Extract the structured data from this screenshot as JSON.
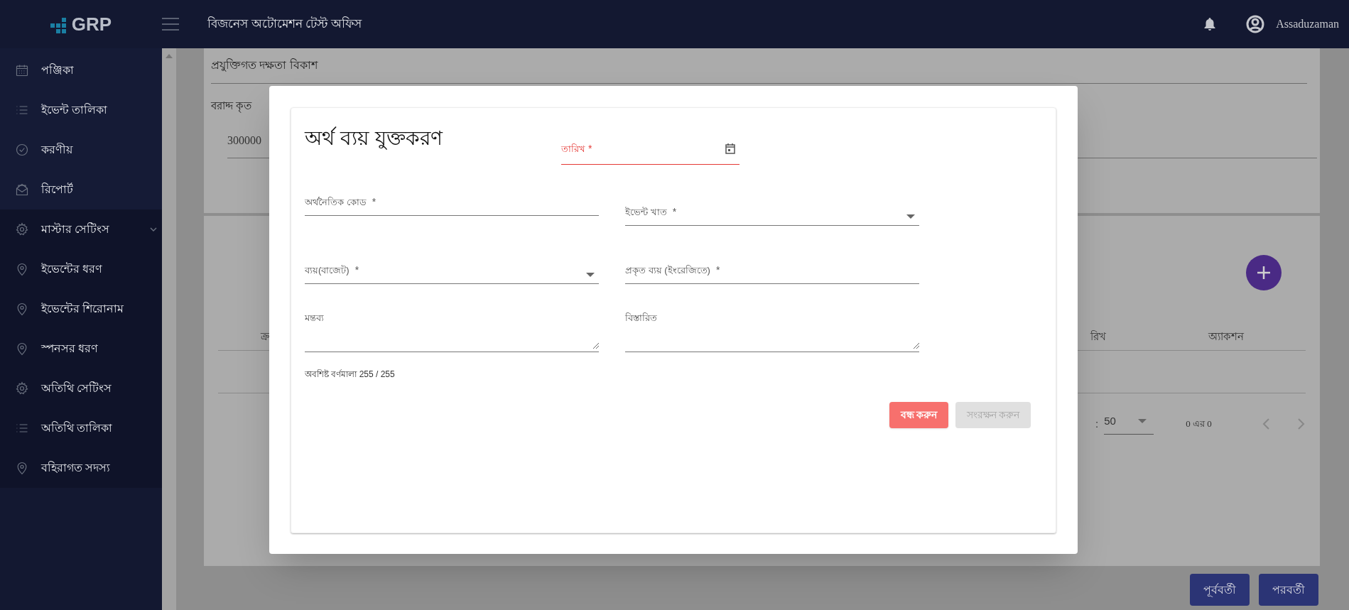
{
  "header": {
    "logo": "GRP",
    "title": "বিজনেস অটোমেশন টেস্ট অফিস",
    "user": "Assaduzaman"
  },
  "sidebar": {
    "items": [
      {
        "label": "পঞ্জিকা",
        "kind": "calendar"
      },
      {
        "label": "ইভেন্ট তালিকা",
        "kind": "list"
      },
      {
        "label": "করণীয়",
        "kind": "check"
      },
      {
        "label": "রিপোর্ট",
        "kind": "mail"
      },
      {
        "label": "মাস্টার সেটিংস",
        "kind": "gear",
        "expanded": true,
        "children": [
          {
            "label": "ইভেন্টের ধরণ",
            "kind": "pin"
          },
          {
            "label": "ইভেন্টের শিরোনাম",
            "kind": "pin"
          },
          {
            "label": "স্পনসর ধরণ",
            "kind": "pin"
          },
          {
            "label": "অতিথি সেটিংস",
            "kind": "gear"
          },
          {
            "label": "অতিথি তালিকা",
            "kind": "list"
          },
          {
            "label": "বহিরাগত সদস্য",
            "kind": "pin"
          }
        ]
      }
    ]
  },
  "page": {
    "topic": "প্রযুক্তিগত দক্ষতা বিকাশ",
    "allocated_label": "বরাদ্দ কৃত",
    "allocated_value": "300000",
    "table": {
      "columns": [
        "ক্র",
        "রিখ",
        "অ্যাকশন"
      ]
    },
    "pagination": {
      "per_page_label": ":",
      "per_page": "50",
      "range": "0 এর 0"
    },
    "buttons": [
      "পূর্ববর্তী",
      "পরবর্তী"
    ]
  },
  "dialog": {
    "title": "অর্থ ব্যয় যুক্তকরণ",
    "date_field": {
      "label": "তারিখ",
      "mark": "*",
      "error": true
    },
    "fields": [
      {
        "kind": "text",
        "label": "অর্থনৈতিক কোড",
        "mark": "*"
      },
      {
        "kind": "select",
        "label": "ইভেন্ট খাত",
        "mark": "*"
      },
      {
        "kind": "select",
        "label": "ব্যয়(বাজেট)",
        "mark": "*"
      },
      {
        "kind": "text",
        "label": "প্রকৃত ব্যয় (ইংরেজিতে)",
        "mark": "*"
      },
      {
        "kind": "textarea",
        "label": "মন্তব্য"
      },
      {
        "kind": "textarea",
        "label": "বিস্তারিত"
      }
    ],
    "counter": "অবশিষ্ট বর্ণমালা 255 / 255",
    "buttons": [
      {
        "label": "বন্ধ করুন",
        "disabled": false
      },
      {
        "label": "সংরক্ষন করুন",
        "disabled": true
      }
    ]
  }
}
